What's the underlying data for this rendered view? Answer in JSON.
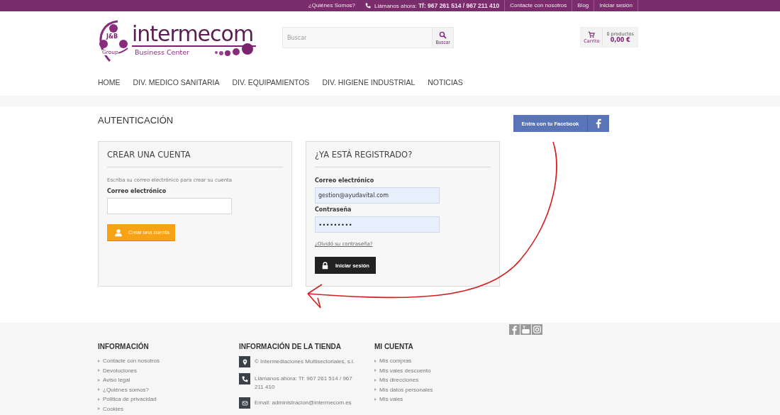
{
  "top_bar": {
    "links": [
      {
        "kind": "link",
        "label": "¿Quiénes Somos?"
      },
      {
        "kind": "phone",
        "label": "Llámanos ahora: **Tf: 967 261 514 / 967 211 410**"
      },
      {
        "kind": "link",
        "label": "Contacte con nosotros"
      },
      {
        "kind": "link",
        "label": "Blog"
      },
      {
        "kind": "link",
        "label": "Iniciar sesión"
      }
    ]
  },
  "logo": {
    "badge": "J&B",
    "badge_sub": "Group",
    "name": "intermecom",
    "tagline": "Business Center"
  },
  "search": {
    "placeholder": "Buscar",
    "button": "Buscar"
  },
  "cart": {
    "label": "Carrito",
    "count": "0 productos",
    "total": "0,00 €"
  },
  "nav": [
    "HOME",
    "DIV. MEDICO SANITARIA",
    "DIV. EQUIPAMIENTOS",
    "DIV. HIGIENE INDUSTRIAL",
    "NOTICIAS"
  ],
  "page_title": "AUTENTICACIÓN",
  "facebook_button": "Entra con tu Facebook",
  "create_account": {
    "title": "CREAR UNA CUENTA",
    "hint": "Escriba su correo electrónico para crear su cuenta",
    "email_label": "Correo electrónico",
    "button": "Crear una cuenta"
  },
  "login": {
    "title": "¿YA ESTÁ REGISTRADO?",
    "email_label": "Correo electrónico",
    "email_value": "gestion@ayudavital.com",
    "password_label": "Contraseña",
    "password_value": "•••••••••",
    "forgot": "¿Olvidó su contraseña?",
    "button": "Iniciar sesión"
  },
  "footer": {
    "columns": [
      {
        "title": "INFORMACIÓN",
        "kind": "links",
        "items": [
          "Contacte con nosotros",
          "Devoluciones",
          "Aviso legal",
          "¿Quiénes somos?",
          "Politica de privacidad",
          "Cookies"
        ]
      },
      {
        "title": "INFORMACIÓN DE LA TIENDA",
        "kind": "contact",
        "items": [
          {
            "text": "© Intermediaciones Multisectoriales, s.l."
          },
          {
            "text": "Llámanos ahora: Tf: 967 261 514 / 967 211 410"
          },
          {
            "text": "Email: administracion@intermecom.es"
          }
        ]
      },
      {
        "title": "MI CUENTA",
        "kind": "links",
        "items": [
          "Mis compras",
          "Mis vales descuento",
          "Mis direcciones",
          "Mis datos personales",
          "Mis vales"
        ]
      }
    ]
  }
}
